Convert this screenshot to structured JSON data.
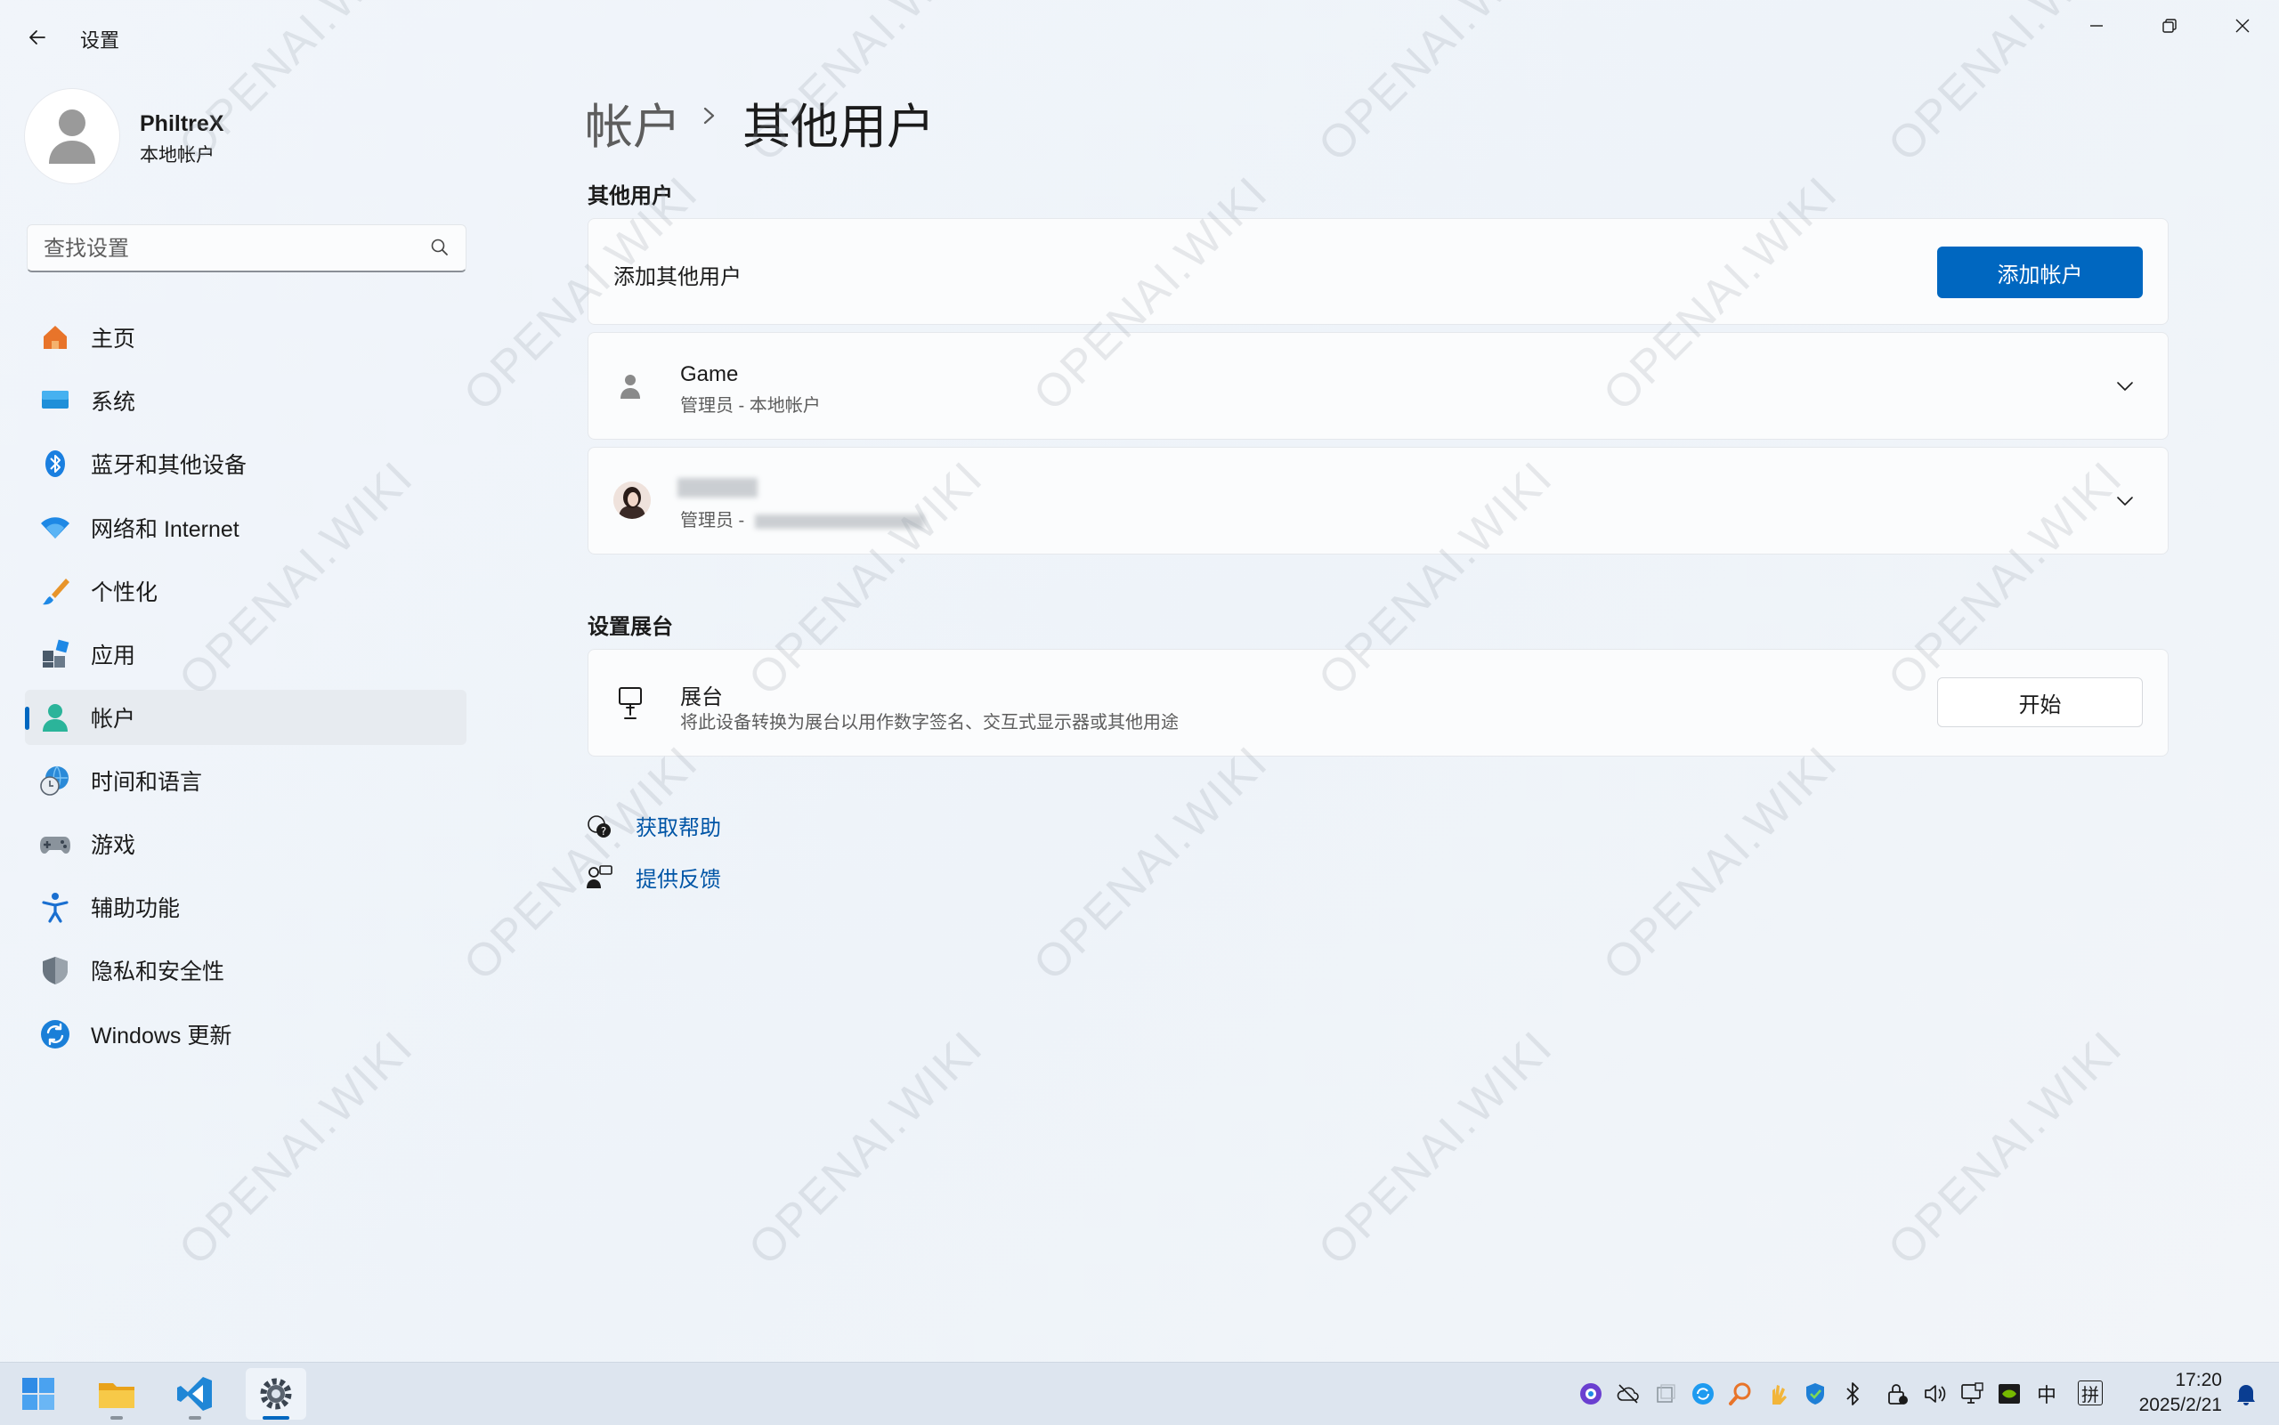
{
  "app": {
    "title": "设置"
  },
  "profile": {
    "name": "PhiltreX",
    "type": "本地帐户"
  },
  "search": {
    "placeholder": "查找设置"
  },
  "nav": {
    "items": [
      {
        "label": "主页",
        "icon": "home-icon",
        "color": "#e8742a"
      },
      {
        "label": "系统",
        "icon": "monitor-icon",
        "color": "#1f8fd9"
      },
      {
        "label": "蓝牙和其他设备",
        "icon": "bluetooth-icon",
        "color": "#1a7fe0"
      },
      {
        "label": "网络和 Internet",
        "icon": "wifi-icon",
        "color": "#1e88e5"
      },
      {
        "label": "个性化",
        "icon": "brush-icon",
        "color": "#e8942a"
      },
      {
        "label": "应用",
        "icon": "apps-icon",
        "color": "#4a5a6a"
      },
      {
        "label": "帐户",
        "icon": "account-icon",
        "color": "#2bb49a"
      },
      {
        "label": "时间和语言",
        "icon": "globe-clock-icon",
        "color": "#2a8ad8"
      },
      {
        "label": "游戏",
        "icon": "gamepad-icon",
        "color": "#707a84"
      },
      {
        "label": "辅助功能",
        "icon": "accessibility-icon",
        "color": "#1a6fd0"
      },
      {
        "label": "隐私和安全性",
        "icon": "shield-icon",
        "color": "#6a7580"
      },
      {
        "label": "Windows 更新",
        "icon": "update-icon",
        "color": "#1a7fd8"
      }
    ],
    "active_index": 6
  },
  "header": {
    "parent": "帐户",
    "separator": "›",
    "current": "其他用户"
  },
  "other_users": {
    "section_label": "其他用户",
    "add_label": "添加其他用户",
    "add_button": "添加帐户",
    "users": [
      {
        "name": "Game",
        "role": "管理员 - 本地帐户"
      },
      {
        "name": "",
        "role": "管理员 -"
      }
    ]
  },
  "kiosk": {
    "section_label": "设置展台",
    "title": "展台",
    "description": "将此设备转换为展台以用作数字签名、交互式显示器或其他用途",
    "button": "开始"
  },
  "links": {
    "help": "获取帮助",
    "feedback": "提供反馈"
  },
  "watermark": "OPENAI.WIKI",
  "taskbar": {
    "tray": {
      "ime_lang": "中",
      "ime_mode": "拼"
    },
    "clock": {
      "time": "17:20",
      "date": "2025/2/21"
    }
  },
  "colors": {
    "accent": "#0067c0",
    "link": "#0055a6"
  }
}
